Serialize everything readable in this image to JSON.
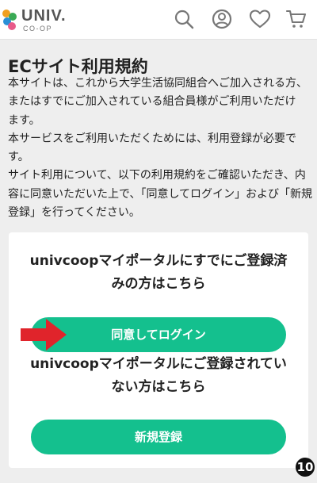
{
  "header": {
    "logo_primary": "UNIV.",
    "logo_secondary": "CO-OP",
    "icons": [
      "search-icon",
      "account-icon",
      "heart-icon",
      "cart-icon"
    ]
  },
  "page": {
    "title": "ECサイト利用規約",
    "intro_lines": [
      "本サイトは、これから大学生活協同組合へご加入される方、",
      "またはすでにご加入されている組合員様がご利用いただけ",
      "ます。",
      "本サービスをご利用いただくためには、利用登録が必要で",
      "す。",
      "サイト利用について、以下の利用規約をご確認いただき、内",
      "容に同意いただいた上で、「同意してログイン」および「新規",
      "登録」を行ってください。"
    ]
  },
  "card": {
    "registered_heading_line1": "univcoopマイポータルにすでにご登録済",
    "registered_heading_line2": "みの方はこちら",
    "login_button": "同意してログイン",
    "unregistered_heading_line1": "univcoopマイポータルにご登録されてい",
    "unregistered_heading_line2": "ない方はこちら",
    "register_button": "新規登録"
  },
  "annotation": {
    "step_number": "10",
    "arrow_color": "#e0242b"
  },
  "colors": {
    "accent": "#14c08e",
    "background": "#eeeeee"
  }
}
